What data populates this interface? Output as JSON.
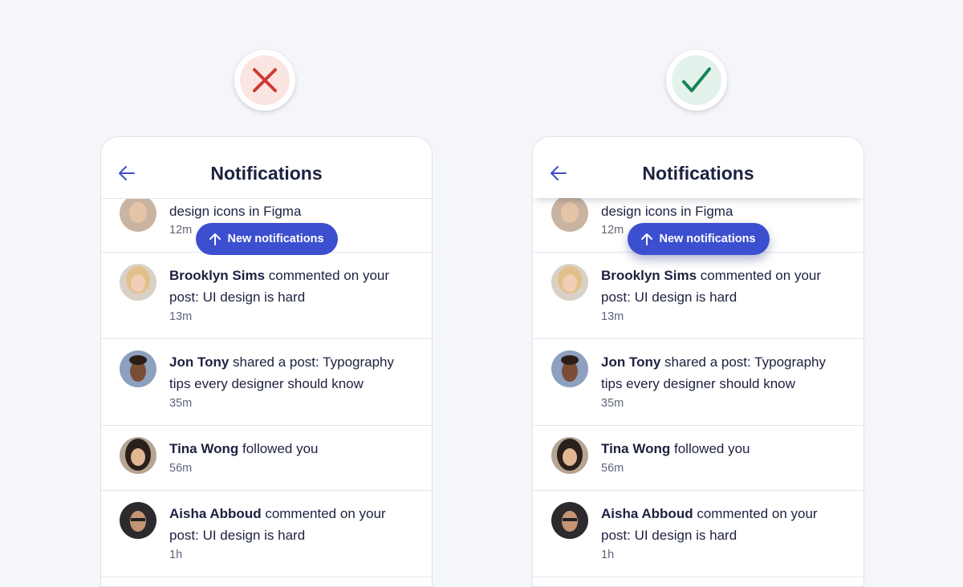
{
  "badges": {
    "bad": {
      "icon": "x-icon",
      "color": "#cf3a30"
    },
    "good": {
      "icon": "checkmark-icon",
      "color": "#15845a"
    }
  },
  "panels": [
    {
      "header": {
        "back_icon": "arrow-left-icon",
        "title": "Notifications"
      },
      "pill_label": "New notifications",
      "notifications": [
        {
          "name": "",
          "action": "design icons in Figma",
          "time": "12m"
        },
        {
          "name": "Brooklyn Sims",
          "action": " commented on your post: UI design is hard",
          "time": "13m"
        },
        {
          "name": "Jon Tony",
          "action": " shared a post: Typography tips every designer should know",
          "time": "35m"
        },
        {
          "name": "Tina Wong",
          "action": " followed you",
          "time": "56m"
        },
        {
          "name": "Aisha Abboud",
          "action": " commented on your post: UI design is hard",
          "time": "1h"
        }
      ]
    },
    {
      "header": {
        "back_icon": "arrow-left-icon",
        "title": "Notifications"
      },
      "pill_label": "New notifications",
      "notifications": [
        {
          "name": "",
          "action": "design icons in Figma",
          "time": "12m"
        },
        {
          "name": "Brooklyn Sims",
          "action": " commented on your post: UI design is hard",
          "time": "13m"
        },
        {
          "name": "Jon Tony",
          "action": " shared a post: Typography tips every designer should know",
          "time": "35m"
        },
        {
          "name": "Tina Wong",
          "action": " followed you",
          "time": "56m"
        },
        {
          "name": "Aisha Abboud",
          "action": " commented on your post: UI design is hard",
          "time": "1h"
        }
      ]
    }
  ],
  "colors": {
    "accent": "#3c4fcf",
    "text": "#1c2140",
    "muted": "#5f6479"
  }
}
